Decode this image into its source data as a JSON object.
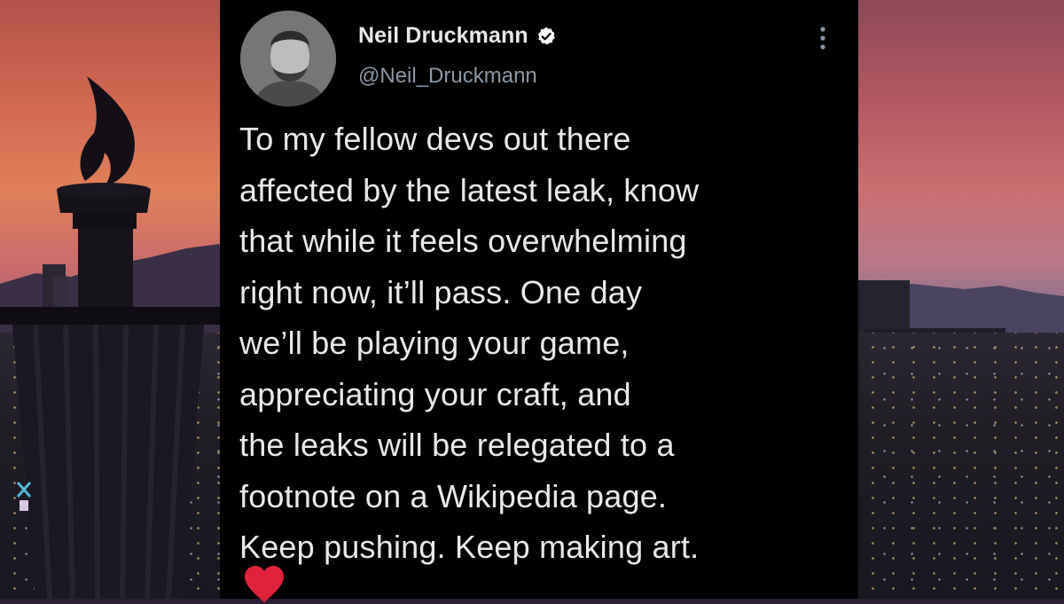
{
  "tweet": {
    "author": {
      "display_name": "Neil Druckmann",
      "handle": "@Neil_Druckmann",
      "verified": true
    },
    "text_lines": [
      "To my fellow devs out there",
      "affected by the latest leak, know",
      "that while it feels overwhelming",
      "right now, it’ll pass. One day",
      "we’ll be playing your game,",
      "appreciating your craft, and",
      "the leaks will be relegated to a",
      "footnote on a Wikipedia page.",
      "Keep pushing. Keep making art."
    ],
    "emoji": "red-heart",
    "colors": {
      "card_bg": "#000000",
      "text": "#e7e9ea",
      "handle": "#8b98a5",
      "verified_badge": "#ffffff",
      "heart": "#e0233a"
    }
  },
  "icons": {
    "verified": "verified-badge-icon",
    "more": "more-options-icon"
  }
}
